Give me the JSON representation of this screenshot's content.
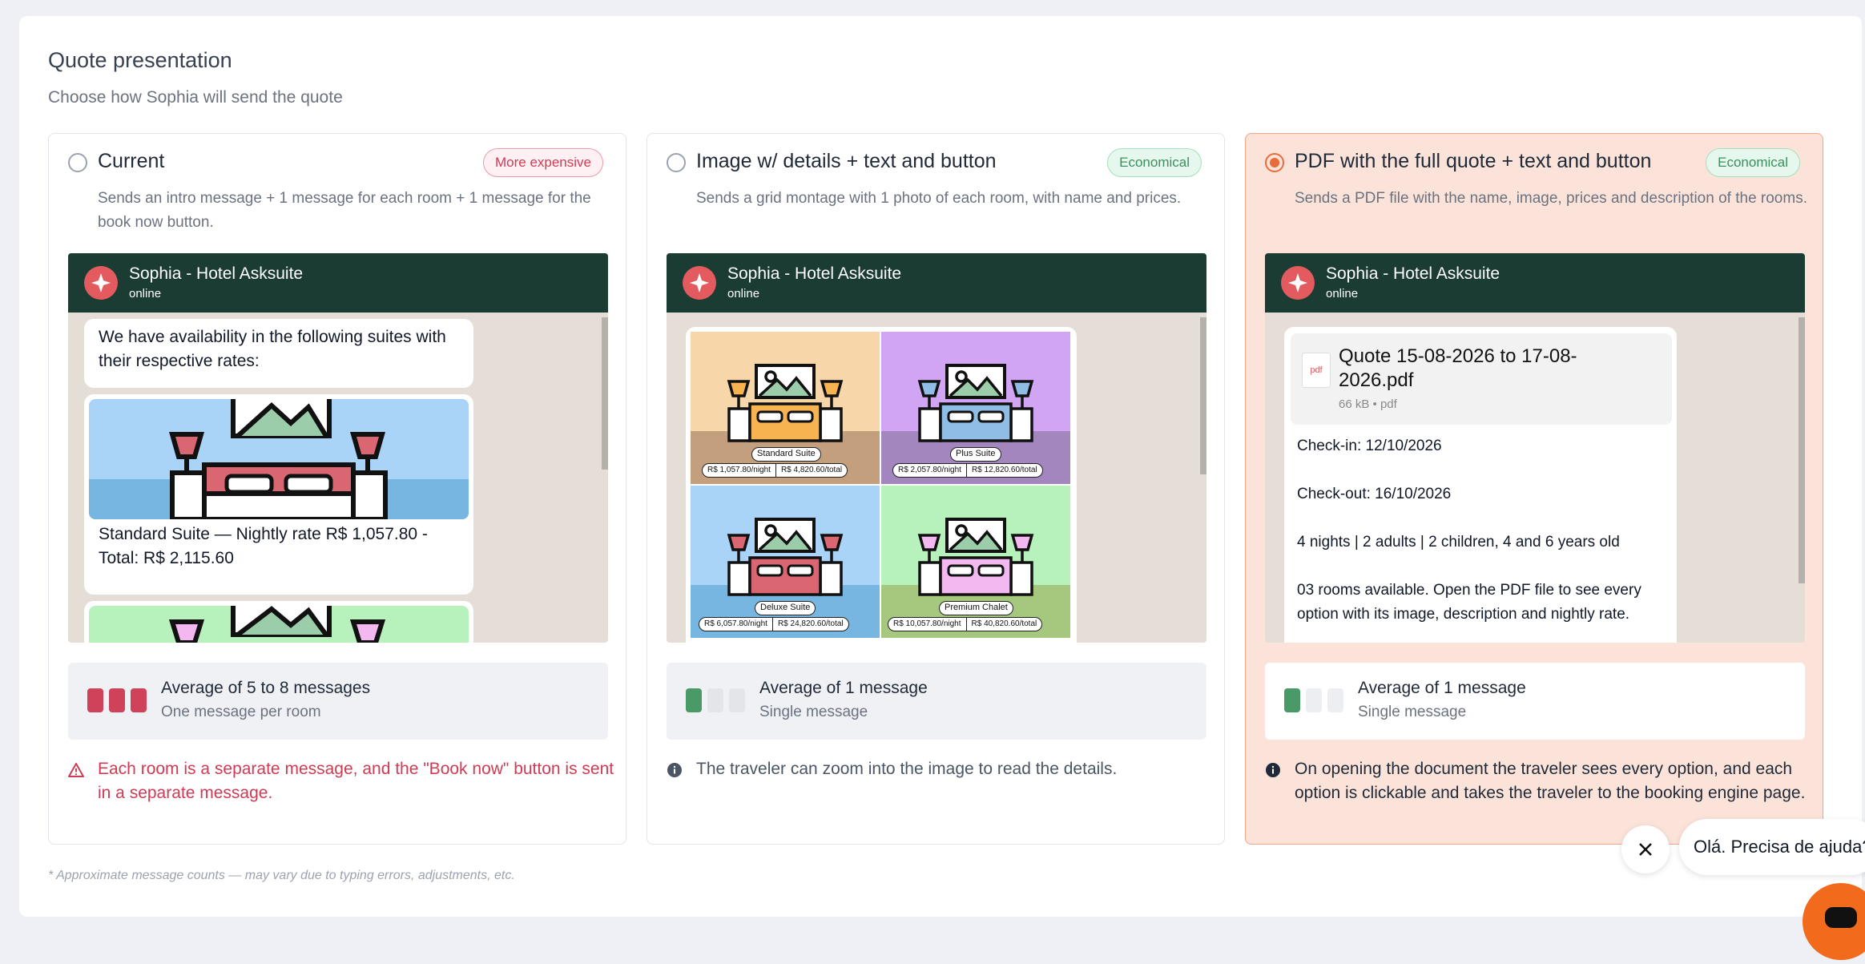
{
  "page": {
    "title": "Quote presentation",
    "subtitle": "Choose how Sophia will send the quote",
    "footnote": "* Approximate message counts — may vary due to typing errors, adjustments, etc."
  },
  "colors": {
    "accent": "#ea6b3a",
    "chat_header": "#1a3c33",
    "danger": "#cf3b55",
    "success": "#3c8f5f"
  },
  "options": [
    {
      "title": "Current",
      "badge": "More expensive",
      "selected": false,
      "description": "Sends an intro message + 1 message for each room + 1 message for the book now button.",
      "chat": {
        "name": "Sophia - Hotel Asksuite",
        "status": "online",
        "intro": "We have availability in the following suites with their respective rates:",
        "room_caption": "Standard Suite — Nightly rate R$ 1,057.80 - Total: R$ 2,115.60"
      },
      "stat": {
        "main": "Average of 5 to 8 messages",
        "sub": "One message per room",
        "filled": 3,
        "total": 3
      },
      "note": "Each room is a separate message, and the \"Book now\" button is sent in a separate message.",
      "note_icon": "warning-icon"
    },
    {
      "title": "Image w/ details + text and button",
      "badge": "Economical",
      "selected": false,
      "description": "Sends a grid montage with 1 photo of each room, with name and prices.",
      "chat": {
        "name": "Sophia - Hotel Asksuite",
        "status": "online",
        "rooms": [
          {
            "name": "Standard Suite",
            "night": "R$ 1,057.80/night",
            "total": "R$ 4,820.60/total"
          },
          {
            "name": "Plus Suite",
            "night": "R$ 2,057.80/night",
            "total": "R$ 12,820.60/total"
          },
          {
            "name": "Deluxe Suite",
            "night": "R$ 6,057.80/night",
            "total": "R$ 24,820.60/total"
          },
          {
            "name": "Premium Chalet",
            "night": "R$ 10,057.80/night",
            "total": "R$ 40,820.60/total"
          }
        ]
      },
      "stat": {
        "main": "Average of 1 message",
        "sub": "Single message",
        "filled": 1,
        "total": 3
      },
      "note": "The traveler can zoom into the image to read the details.",
      "note_icon": "info-icon"
    },
    {
      "title": "PDF with the full quote + text and button",
      "badge": "Economical",
      "selected": true,
      "description": "Sends a PDF file with the name, image, prices and description of the rooms.",
      "chat": {
        "name": "Sophia - Hotel Asksuite",
        "status": "online",
        "pdf_icon": "pdf",
        "pdf_name": "Quote 15-08-2026 to 17-08-2026.pdf",
        "pdf_meta": "66 kB • pdf",
        "checkin": "Check-in: 12/10/2026",
        "checkout": "Check-out: 16/10/2026",
        "guests": "4 nights | 2 adults | 2 children, 4 and 6 years old",
        "availability": "03 rooms available. Open the PDF file to see every option with its image, description and nightly rate."
      },
      "stat": {
        "main": "Average of 1 message",
        "sub": "Single message",
        "filled": 1,
        "total": 3
      },
      "note": "On opening the document the traveler sees every option, and each option is clickable and takes the traveler to the booking engine page.",
      "note_icon": "info-icon"
    }
  ],
  "help_widget": {
    "message": "Olá. Precisa de ajuda?",
    "close_icon": "close-icon",
    "launcher_icon": "chat-icon"
  }
}
